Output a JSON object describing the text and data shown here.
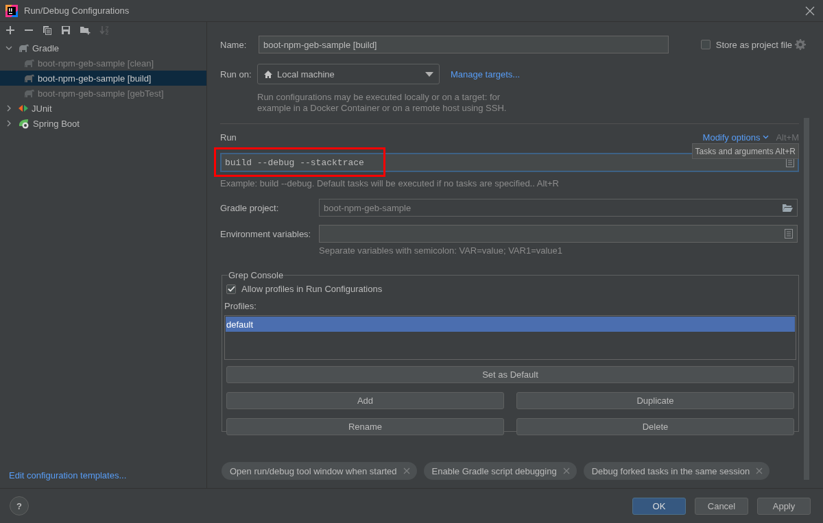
{
  "window": {
    "title": "Run/Debug Configurations"
  },
  "toolbar": [
    {
      "kind": "add",
      "disabled": false
    },
    {
      "kind": "remove",
      "disabled": false
    },
    {
      "kind": "copy",
      "disabled": false
    },
    {
      "kind": "save",
      "disabled": false
    },
    {
      "kind": "new-folder",
      "disabled": false
    },
    {
      "kind": "sort",
      "disabled": true
    }
  ],
  "tree": [
    {
      "label": "Gradle",
      "kind": "gradle",
      "expanded": true,
      "selected": false,
      "children": [
        {
          "label": "boot-npm-geb-sample [clean]",
          "kind": "gradle",
          "selected": false
        },
        {
          "label": "boot-npm-geb-sample [build]",
          "kind": "gradle",
          "selected": true
        },
        {
          "label": "boot-npm-geb-sample [gebTest]",
          "kind": "gradle",
          "selected": false
        }
      ]
    },
    {
      "label": "JUnit",
      "kind": "junit",
      "expanded": false,
      "selected": false
    },
    {
      "label": "Spring Boot",
      "kind": "spring",
      "expanded": false,
      "selected": false
    }
  ],
  "templates_link": "Edit configuration templates...",
  "name": {
    "label": "Name:",
    "value": "boot-npm-geb-sample [build]"
  },
  "store_as_project_file": {
    "label": "Store as project file",
    "checked": false
  },
  "run_on": {
    "label": "Run on:",
    "value": "Local machine",
    "link": "Manage targets...",
    "hint": "Run configurations may be executed locally or on a target: for example in a Docker Container or on a remote host using SSH."
  },
  "run_section": {
    "title": "Run",
    "modify_options": "Modify options",
    "modify_shortcut": "Alt+M",
    "tooltip": "Tasks and arguments Alt+R",
    "tasks": {
      "value": "build --debug --stacktrace",
      "focused": true,
      "highlighted": true
    },
    "hint": "Example: build --debug. Default tasks will be executed if no tasks are specified.. Alt+R"
  },
  "gradle_project": {
    "label": "Gradle project:",
    "value": "boot-npm-geb-sample"
  },
  "environment_variables": {
    "label": "Environment variables:",
    "hint": "Separate variables with semicolon: VAR=value; VAR1=value1"
  },
  "grep_console": {
    "title": "Grep Console",
    "allow_profiles": {
      "label": "Allow profiles in Run Configurations",
      "checked": true
    },
    "profiles_label": "Profiles:",
    "profiles": [
      {
        "label": "default",
        "selected": true
      }
    ],
    "buttons": [
      {
        "label": "Set as Default"
      },
      {
        "label": "Add"
      },
      {
        "label": "Duplicate"
      },
      {
        "label": "Rename"
      },
      {
        "label": "Delete"
      }
    ]
  },
  "options": [
    {
      "label": "Open run/debug tool window when started"
    },
    {
      "label": "Enable Gradle script debugging"
    },
    {
      "label": "Debug forked tasks in the same session"
    }
  ],
  "help": "?",
  "buttons": [
    {
      "label": "OK",
      "primary": true
    },
    {
      "label": "Cancel",
      "primary": false
    },
    {
      "label": "Apply",
      "primary": false
    }
  ]
}
